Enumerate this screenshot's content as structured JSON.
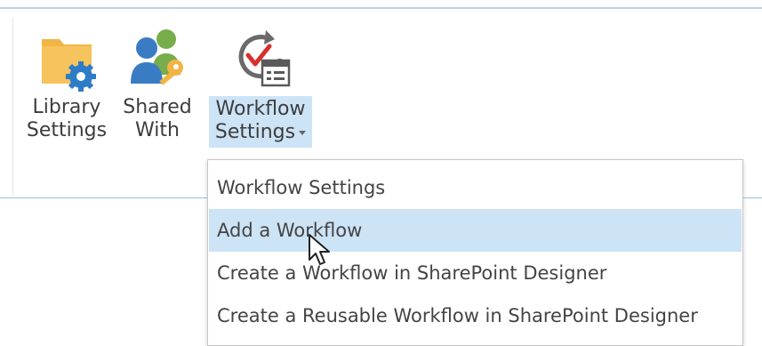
{
  "ribbon": {
    "library_settings": {
      "line1": "Library",
      "line2": "Settings",
      "icon": "folder-gear-icon"
    },
    "shared_with": {
      "line1": "Shared",
      "line2": "With",
      "icon": "users-key-icon"
    },
    "workflow_settings": {
      "line1": "Workflow",
      "line2": "Settings",
      "icon": "workflow-calendar-icon",
      "expanded": true
    }
  },
  "menu": {
    "items": [
      {
        "label": "Workflow Settings",
        "hovered": false
      },
      {
        "label": "Add a Workflow",
        "hovered": true
      },
      {
        "label": "Create a Workflow in SharePoint Designer",
        "hovered": false
      },
      {
        "label": "Create a Reusable Workflow in SharePoint Designer",
        "hovered": false
      }
    ]
  },
  "colors": {
    "accent_light": "#cde3f6",
    "rule_blue": "#9cbfe3",
    "folder": "#f0b545",
    "gear": "#2d7cc7",
    "user_blue": "#3a7cc4",
    "user_green": "#77ad4a",
    "key": "#f2b544",
    "check_red": "#d9302c"
  }
}
